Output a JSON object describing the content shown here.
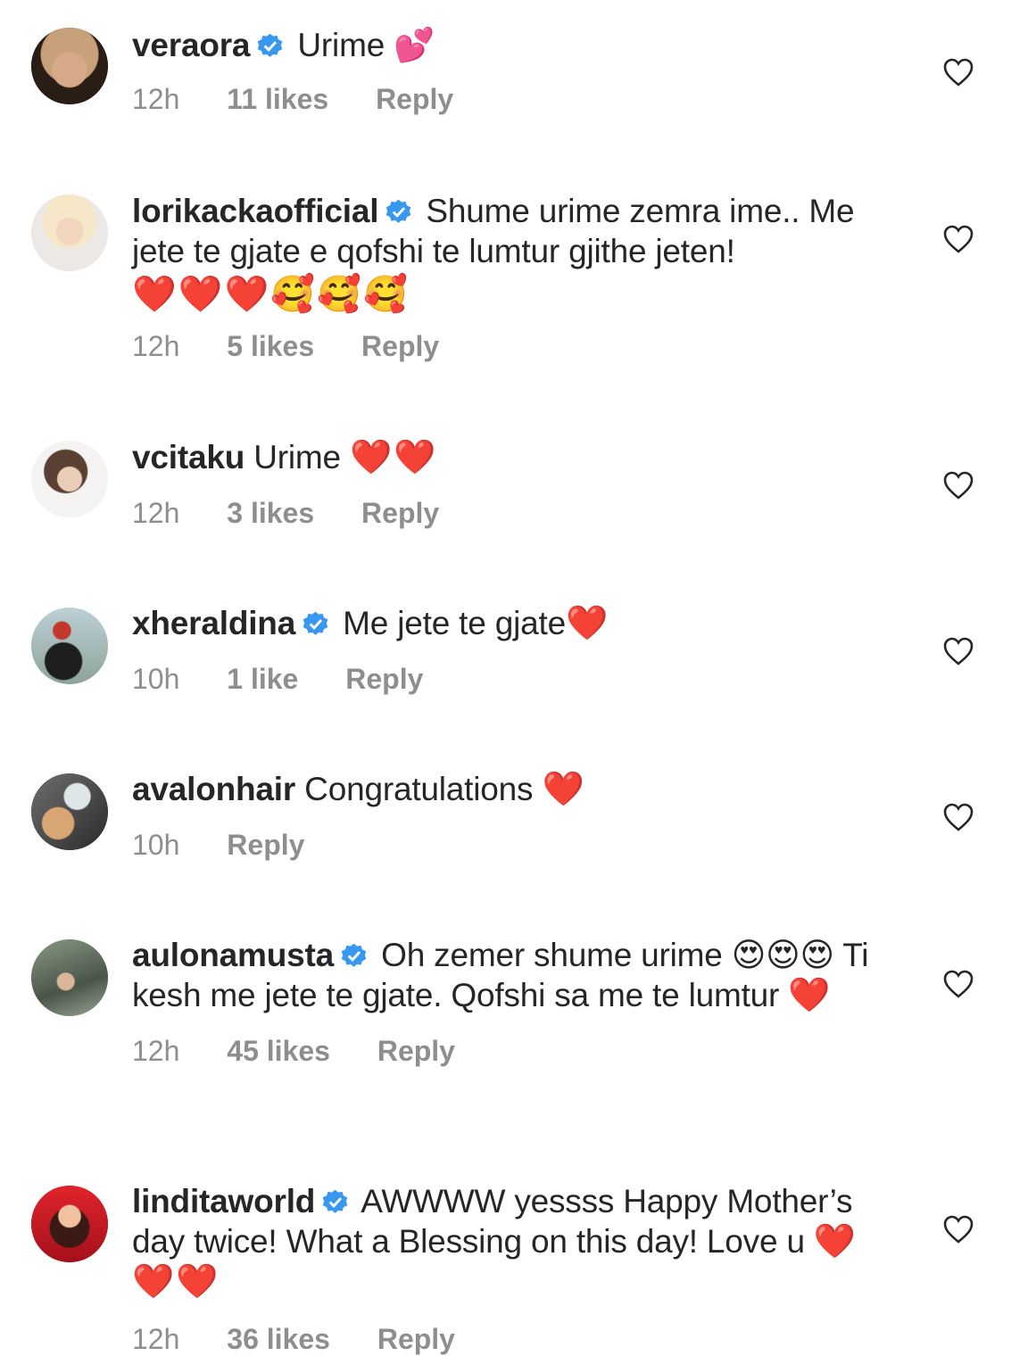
{
  "comments": [
    {
      "username": "veraora",
      "verified": true,
      "text": "Urime",
      "emojis": "💕",
      "time": "12h",
      "likes": "11 likes",
      "reply": "Reply"
    },
    {
      "username": "lorikackaofficial",
      "verified": true,
      "text": "Shume urime zemra ime.. Me jete te gjate e qofshi te lumtur gjithe jeten!",
      "emojis": "❤️❤️❤️🥰🥰🥰",
      "time": "12h",
      "likes": "5 likes",
      "reply": "Reply"
    },
    {
      "username": "vcitaku",
      "verified": false,
      "text": "Urime",
      "emojis": "❤️❤️",
      "time": "12h",
      "likes": "3 likes",
      "reply": "Reply"
    },
    {
      "username": "xheraldina",
      "verified": true,
      "text": "Me jete te gjate",
      "emojis": "❤️",
      "time": "10h",
      "likes": "1 like",
      "reply": "Reply"
    },
    {
      "username": "avalonhair",
      "verified": false,
      "text": "Congratulations",
      "emojis": "❤️",
      "time": "10h",
      "likes": "",
      "reply": "Reply"
    },
    {
      "username": "aulonamusta",
      "verified": true,
      "text": "Oh zemer shume urime 😍😍😍 Ti kesh me jete te gjate. Qofshi sa me te lumtur",
      "emojis": "❤️",
      "time": "12h",
      "likes": "45 likes",
      "reply": "Reply"
    },
    {
      "username": "linditaworld",
      "verified": true,
      "text": "AWWWW yessss Happy Mother’s day twice! What a Blessing on this day! Love u",
      "emojis": "❤️❤️❤️",
      "time": "12h",
      "likes": "36 likes",
      "reply": "Reply"
    }
  ],
  "colors": {
    "text": "#262626",
    "meta": "#8e8e8e",
    "verified": "#3897f0",
    "heart_outline": "#262626"
  }
}
